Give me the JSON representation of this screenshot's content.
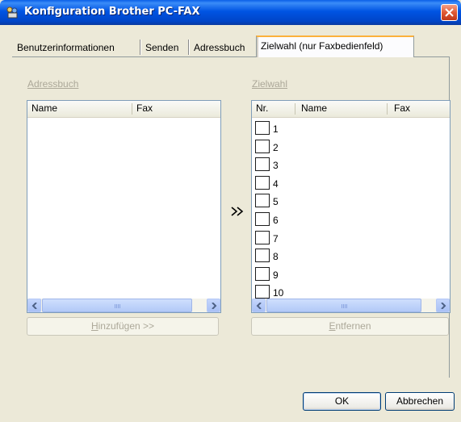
{
  "window": {
    "title": "Konfiguration Brother PC-FAX"
  },
  "tabs": [
    {
      "label": "Benutzerinformationen"
    },
    {
      "label": "Senden"
    },
    {
      "label": "Adressbuch"
    },
    {
      "label": "Zielwahl (nur Faxbedienfeld)",
      "active": true
    }
  ],
  "address_book": {
    "group_label": "Adressbuch",
    "columns": [
      "Name",
      "Fax"
    ],
    "rows": [],
    "add_button": {
      "accel": "H",
      "rest": "inzufügen >>"
    }
  },
  "speed_dial": {
    "group_label": "Zielwahl",
    "columns": [
      "Nr.",
      "Name",
      "Fax"
    ],
    "rows": [
      {
        "nr": "1"
      },
      {
        "nr": "2"
      },
      {
        "nr": "3"
      },
      {
        "nr": "4"
      },
      {
        "nr": "5"
      },
      {
        "nr": "6"
      },
      {
        "nr": "7"
      },
      {
        "nr": "8"
      },
      {
        "nr": "9"
      },
      {
        "nr": "10"
      }
    ],
    "remove_button": {
      "accel": "E",
      "rest": "ntfernen"
    }
  },
  "transfer_arrow": "»",
  "footer": {
    "ok_label": "OK",
    "cancel_label": "Abbrechen"
  }
}
